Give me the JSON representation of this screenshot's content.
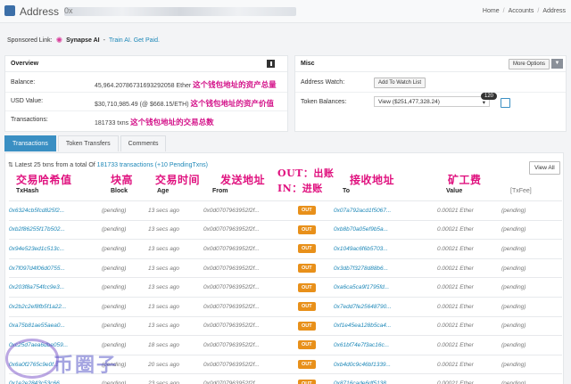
{
  "header": {
    "title": "Address",
    "address_prefix": "0x",
    "breadcrumbs": [
      "Home",
      "Accounts",
      "Address"
    ]
  },
  "sponsor": {
    "label": "Sponsored Link:",
    "name": "Synapse AI",
    "tagline": "Train AI. Get Paid."
  },
  "overview": {
    "title": "Overview",
    "balance_label": "Balance:",
    "balance_value": "45,964.20786731693292058 Ether",
    "balance_note": "这个钱包地址的资产总量",
    "usd_label": "USD Value:",
    "usd_value": "$30,710,985.49 (@ $668.15/ETH)",
    "usd_note": "这个钱包地址的资产价值",
    "tx_label": "Transactions:",
    "tx_value": "181733 txns",
    "tx_note": "这个钱包地址的交易总数"
  },
  "misc": {
    "title": "Misc",
    "more_options": "More Options",
    "address_watch_label": "Address Watch:",
    "watch_button": "Add To Watch List",
    "token_balances_label": "Token Balances:",
    "token_view": "View ($251,477,328.24)",
    "token_count": "120"
  },
  "tabs": [
    "Transactions",
    "Token Transfers",
    "Comments"
  ],
  "summary": {
    "prefix": "Latest 25 txns from a total Of",
    "link": "181733 transactions",
    "pending": "(+10 PendingTxns)"
  },
  "view_all": "View All",
  "annotations": {
    "txhash": "交易哈希值",
    "block": "块高",
    "age": "交易时间",
    "from": "发送地址",
    "out": "OUT：出账",
    "in": "IN：进账",
    "to": "接收地址",
    "fee": "矿工费"
  },
  "columns": [
    "TxHash",
    "Block",
    "Age",
    "From",
    "To",
    "Value",
    "[TxFee]"
  ],
  "rows": [
    {
      "hash": "0x6324cb5fcd825f2...",
      "block": "(pending)",
      "age": "13 secs ago",
      "from": "0x0d0707963952f2f...",
      "dir": "OUT",
      "to": "0x07a792acd1f5067...",
      "value": "0.00021 Ether",
      "fee": "(pending)"
    },
    {
      "hash": "0xb2f86255f17b502...",
      "block": "(pending)",
      "age": "13 secs ago",
      "from": "0x0d0707963952f2f...",
      "dir": "OUT",
      "to": "0xb8b70a05ef9b5a...",
      "value": "0.00021 Ether",
      "fee": "(pending)"
    },
    {
      "hash": "0x94e523ed1c513c...",
      "block": "(pending)",
      "age": "13 secs ago",
      "from": "0x0d0707963952f2f...",
      "dir": "OUT",
      "to": "0x1049ac6f6b5703...",
      "value": "0.00021 Ether",
      "fee": "(pending)"
    },
    {
      "hash": "0x7f097d4f06d0755...",
      "block": "(pending)",
      "age": "13 secs ago",
      "from": "0x0d0707963952f2f...",
      "dir": "OUT",
      "to": "0x3db7f3278d88b6...",
      "value": "0.00021 Ether",
      "fee": "(pending)"
    },
    {
      "hash": "0x203f8a754fcc9e3...",
      "block": "(pending)",
      "age": "13 secs ago",
      "from": "0x0d0707963952f2f...",
      "dir": "OUT",
      "to": "0xa6ca5ca9f1795fd...",
      "value": "0.00021 Ether",
      "fee": "(pending)"
    },
    {
      "hash": "0x2b2c2ef8fb5f1a22...",
      "block": "(pending)",
      "age": "13 secs ago",
      "from": "0x0d0707963952f2f...",
      "dir": "OUT",
      "to": "0x7edd7fe25648790...",
      "value": "0.00021 Ether",
      "fee": "(pending)"
    },
    {
      "hash": "0xa75b81ae55aea0...",
      "block": "(pending)",
      "age": "13 secs ago",
      "from": "0x0d0707963952f2f...",
      "dir": "OUT",
      "to": "0xf1e45ea128b5ca4...",
      "value": "0.00021 Ether",
      "fee": "(pending)"
    },
    {
      "hash": "0xc25d7aea6dbe059...",
      "block": "(pending)",
      "age": "18 secs ago",
      "from": "0x0d0707963952f2f...",
      "dir": "OUT",
      "to": "0x61bf74e7f3ac16c...",
      "value": "0.00021 Ether",
      "fee": "(pending)"
    },
    {
      "hash": "0x6a0f2765c9e0f...",
      "block": "(pending)",
      "age": "20 secs ago",
      "from": "0x0d0707963952f2f...",
      "dir": "OUT",
      "to": "0xb4d0c9c46bf1339...",
      "value": "0.00021 Ether",
      "fee": "(pending)"
    },
    {
      "hash": "0x1e2e2843c53c66...",
      "block": "(pending)",
      "age": "23 secs ago",
      "from": "0x0d0707963952f2f...",
      "dir": "OUT",
      "to": "0x8716cade6df5138...",
      "value": "0.00021 Ether",
      "fee": "(pending)"
    }
  ],
  "watermark": {
    "text": "币圈子"
  },
  "colors": {
    "accent": "#3a8fc3",
    "link": "#1e88b8",
    "annotation": "#e0127f",
    "out_badge": "#e8901a"
  }
}
